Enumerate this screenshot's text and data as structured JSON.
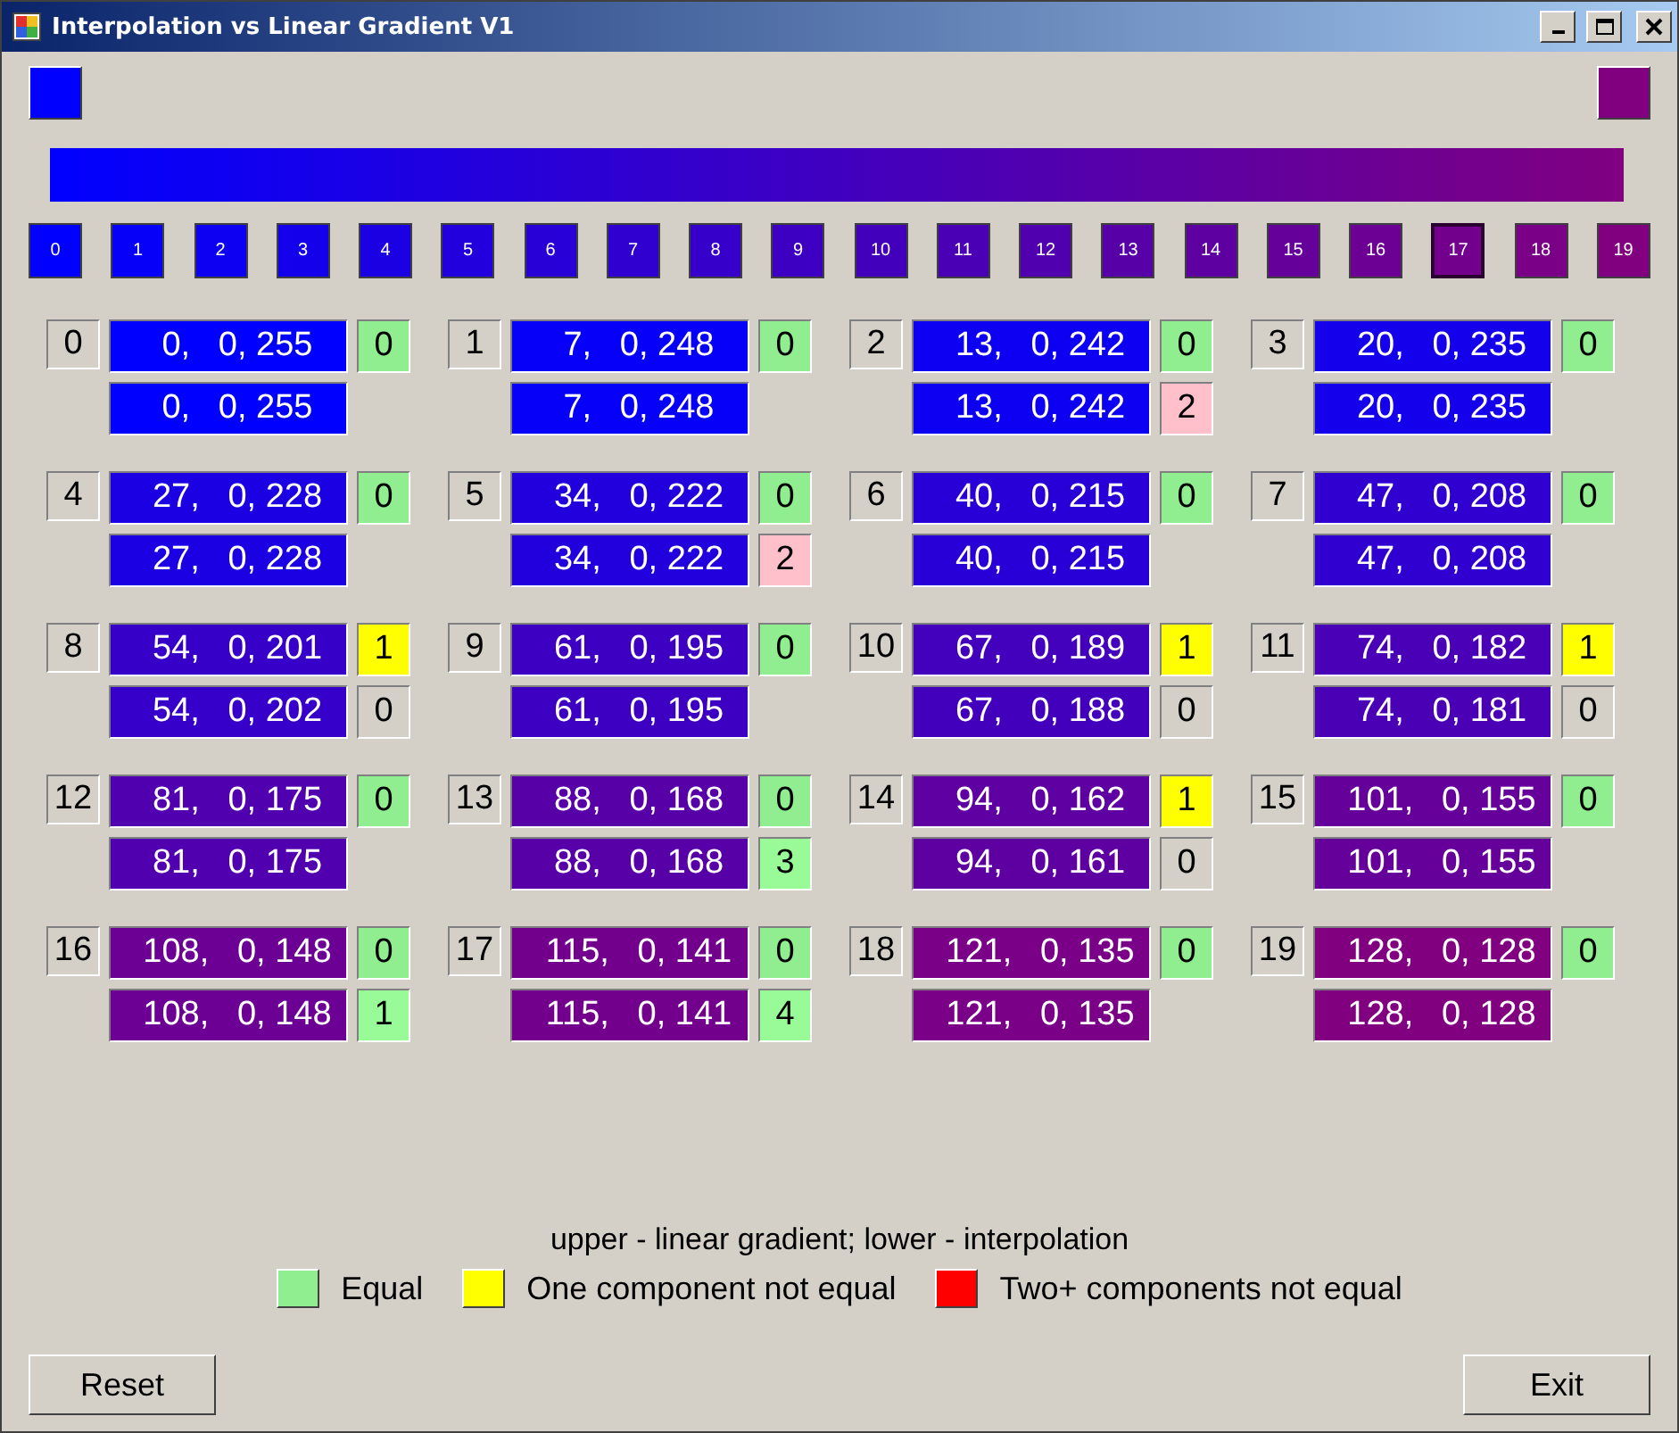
{
  "window": {
    "title": "Interpolation vs Linear Gradient V1"
  },
  "endpoints": [
    {
      "color": "#0000ff"
    },
    {
      "color": "#800080"
    }
  ],
  "swatches": [
    {
      "label": "0",
      "color": "#0000ff",
      "selected": false
    },
    {
      "label": "1",
      "color": "#0700f8",
      "selected": false
    },
    {
      "label": "2",
      "color": "#0d00f2",
      "selected": false
    },
    {
      "label": "3",
      "color": "#1400eb",
      "selected": false
    },
    {
      "label": "4",
      "color": "#1b00e4",
      "selected": false
    },
    {
      "label": "5",
      "color": "#2200de",
      "selected": false
    },
    {
      "label": "6",
      "color": "#2800d7",
      "selected": false
    },
    {
      "label": "7",
      "color": "#2f00d0",
      "selected": false
    },
    {
      "label": "8",
      "color": "#3600ca",
      "selected": false
    },
    {
      "label": "9",
      "color": "#3d00c3",
      "selected": false
    },
    {
      "label": "10",
      "color": "#4300bc",
      "selected": false
    },
    {
      "label": "11",
      "color": "#4a00b5",
      "selected": false
    },
    {
      "label": "12",
      "color": "#5100af",
      "selected": false
    },
    {
      "label": "13",
      "color": "#5800a8",
      "selected": false
    },
    {
      "label": "14",
      "color": "#5e00a1",
      "selected": false
    },
    {
      "label": "15",
      "color": "#65009b",
      "selected": false
    },
    {
      "label": "16",
      "color": "#6c0094",
      "selected": false
    },
    {
      "label": "17",
      "color": "#73008d",
      "selected": true
    },
    {
      "label": "18",
      "color": "#790087",
      "selected": false
    },
    {
      "label": "19",
      "color": "#800080",
      "selected": false
    }
  ],
  "cells": [
    {
      "index": "0",
      "upper": {
        "text": "0,   0, 255",
        "color": "#0000ff"
      },
      "upper_diff": {
        "text": "0",
        "color": "#90ee90"
      },
      "lower": {
        "text": "0,   0, 255",
        "color": "#0000ff"
      }
    },
    {
      "index": "1",
      "upper": {
        "text": "7,   0, 248",
        "color": "#0700f8"
      },
      "upper_diff": {
        "text": "0",
        "color": "#90ee90"
      },
      "lower": {
        "text": "7,   0, 248",
        "color": "#0700f8"
      }
    },
    {
      "index": "2",
      "upper": {
        "text": "13,   0, 242",
        "color": "#0d00f2"
      },
      "upper_diff": {
        "text": "0",
        "color": "#90ee90"
      },
      "lower": {
        "text": "13,   0, 242",
        "color": "#0d00f2"
      },
      "lower_diff": {
        "text": "2",
        "color": "#ffc0cb"
      }
    },
    {
      "index": "3",
      "upper": {
        "text": "20,   0, 235",
        "color": "#1400eb"
      },
      "upper_diff": {
        "text": "0",
        "color": "#90ee90"
      },
      "lower": {
        "text": "20,   0, 235",
        "color": "#1400eb"
      }
    },
    {
      "index": "4",
      "upper": {
        "text": "27,   0, 228",
        "color": "#1b00e4"
      },
      "upper_diff": {
        "text": "0",
        "color": "#90ee90"
      },
      "lower": {
        "text": "27,   0, 228",
        "color": "#1b00e4"
      }
    },
    {
      "index": "5",
      "upper": {
        "text": "34,   0, 222",
        "color": "#2200de"
      },
      "upper_diff": {
        "text": "0",
        "color": "#90ee90"
      },
      "lower": {
        "text": "34,   0, 222",
        "color": "#2200de"
      },
      "lower_diff": {
        "text": "2",
        "color": "#ffc0cb"
      }
    },
    {
      "index": "6",
      "upper": {
        "text": "40,   0, 215",
        "color": "#2800d7"
      },
      "upper_diff": {
        "text": "0",
        "color": "#90ee90"
      },
      "lower": {
        "text": "40,   0, 215",
        "color": "#2800d7"
      }
    },
    {
      "index": "7",
      "upper": {
        "text": "47,   0, 208",
        "color": "#2f00d0"
      },
      "upper_diff": {
        "text": "0",
        "color": "#90ee90"
      },
      "lower": {
        "text": "47,   0, 208",
        "color": "#2f00d0"
      }
    },
    {
      "index": "8",
      "upper": {
        "text": "54,   0, 201",
        "color": "#3600c9"
      },
      "upper_diff": {
        "text": "1",
        "color": "#ffff00"
      },
      "lower": {
        "text": "54,   0, 202",
        "color": "#3600ca"
      },
      "lower_diff": {
        "text": "0",
        "color": "#d4d0c8"
      }
    },
    {
      "index": "9",
      "upper": {
        "text": "61,   0, 195",
        "color": "#3d00c3"
      },
      "upper_diff": {
        "text": "0",
        "color": "#90ee90"
      },
      "lower": {
        "text": "61,   0, 195",
        "color": "#3d00c3"
      }
    },
    {
      "index": "10",
      "upper": {
        "text": "67,   0, 189",
        "color": "#4300bd"
      },
      "upper_diff": {
        "text": "1",
        "color": "#ffff00"
      },
      "lower": {
        "text": "67,   0, 188",
        "color": "#4300bc"
      },
      "lower_diff": {
        "text": "0",
        "color": "#d4d0c8"
      }
    },
    {
      "index": "11",
      "upper": {
        "text": "74,   0, 182",
        "color": "#4a00b6"
      },
      "upper_diff": {
        "text": "1",
        "color": "#ffff00"
      },
      "lower": {
        "text": "74,   0, 181",
        "color": "#4a00b5"
      },
      "lower_diff": {
        "text": "0",
        "color": "#d4d0c8"
      }
    },
    {
      "index": "12",
      "upper": {
        "text": "81,   0, 175",
        "color": "#5100af"
      },
      "upper_diff": {
        "text": "0",
        "color": "#90ee90"
      },
      "lower": {
        "text": "81,   0, 175",
        "color": "#5100af"
      }
    },
    {
      "index": "13",
      "upper": {
        "text": "88,   0, 168",
        "color": "#5800a8"
      },
      "upper_diff": {
        "text": "0",
        "color": "#90ee90"
      },
      "lower": {
        "text": "88,   0, 168",
        "color": "#5800a8"
      },
      "lower_diff": {
        "text": "3",
        "color": "#98fb98"
      }
    },
    {
      "index": "14",
      "upper": {
        "text": "94,   0, 162",
        "color": "#5e00a2"
      },
      "upper_diff": {
        "text": "1",
        "color": "#ffff00"
      },
      "lower": {
        "text": "94,   0, 161",
        "color": "#5e00a1"
      },
      "lower_diff": {
        "text": "0",
        "color": "#d4d0c8"
      }
    },
    {
      "index": "15",
      "upper": {
        "text": "101,   0, 155",
        "color": "#65009b"
      },
      "upper_diff": {
        "text": "0",
        "color": "#90ee90"
      },
      "lower": {
        "text": "101,   0, 155",
        "color": "#65009b"
      }
    },
    {
      "index": "16",
      "upper": {
        "text": "108,   0, 148",
        "color": "#6c0094"
      },
      "upper_diff": {
        "text": "0",
        "color": "#90ee90"
      },
      "lower": {
        "text": "108,   0, 148",
        "color": "#6c0094"
      },
      "lower_diff": {
        "text": "1",
        "color": "#98fb98"
      }
    },
    {
      "index": "17",
      "upper": {
        "text": "115,   0, 141",
        "color": "#73008d"
      },
      "upper_diff": {
        "text": "0",
        "color": "#90ee90"
      },
      "lower": {
        "text": "115,   0, 141",
        "color": "#73008d"
      },
      "lower_diff": {
        "text": "4",
        "color": "#98fb98"
      }
    },
    {
      "index": "18",
      "upper": {
        "text": "121,   0, 135",
        "color": "#790087"
      },
      "upper_diff": {
        "text": "0",
        "color": "#90ee90"
      },
      "lower": {
        "text": "121,   0, 135",
        "color": "#790087"
      }
    },
    {
      "index": "19",
      "upper": {
        "text": "128,   0, 128",
        "color": "#800080"
      },
      "upper_diff": {
        "text": "0",
        "color": "#90ee90"
      },
      "lower": {
        "text": "128,   0, 128",
        "color": "#800080"
      }
    }
  ],
  "caption": "upper - linear gradient; lower - interpolation",
  "legend": [
    {
      "label": "Equal",
      "color": "#90ee90"
    },
    {
      "label": "One component not equal",
      "color": "#ffff00"
    },
    {
      "label": "Two+ components not equal",
      "color": "#ff0000"
    }
  ],
  "buttons": [
    {
      "label": "Reset"
    },
    {
      "label": "Exit"
    }
  ]
}
